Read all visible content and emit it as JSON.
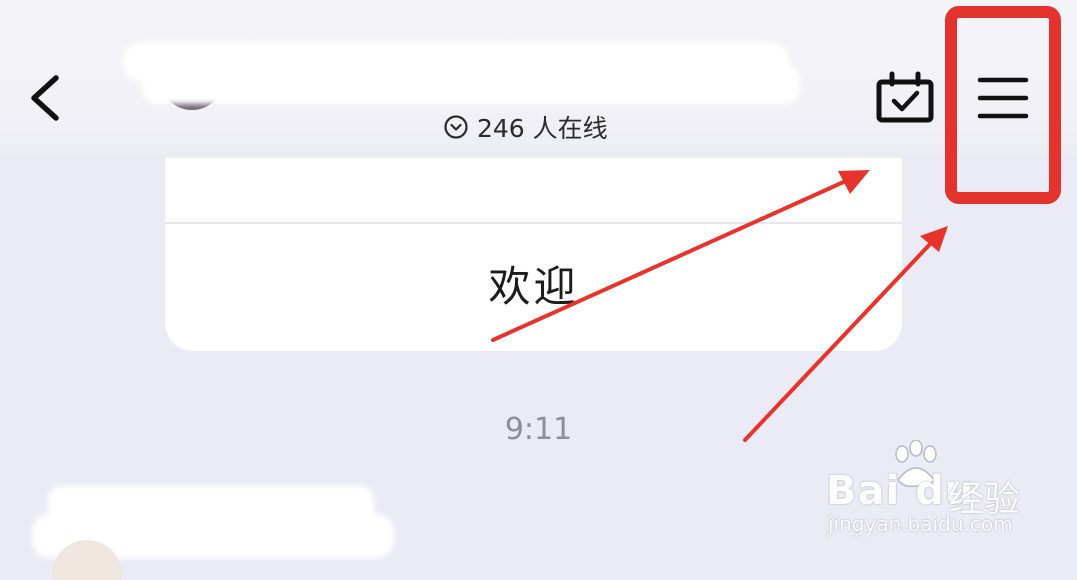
{
  "header": {
    "online_status": "246 人在线",
    "icons": {
      "back": "chevron-left-icon",
      "calendar": "calendar-check-icon",
      "menu": "hamburger-menu-icon",
      "online": "chevron-down-circle-icon"
    }
  },
  "message_card": {
    "text": "欢迎"
  },
  "timestamp": "9:11",
  "watermark": {
    "logo": "Bai  du",
    "cn": "经验",
    "url": "jingyan.baidu.com"
  },
  "colors": {
    "highlight": "#e3332d",
    "background": "#ebebf5",
    "arrow": "#e8322c"
  }
}
